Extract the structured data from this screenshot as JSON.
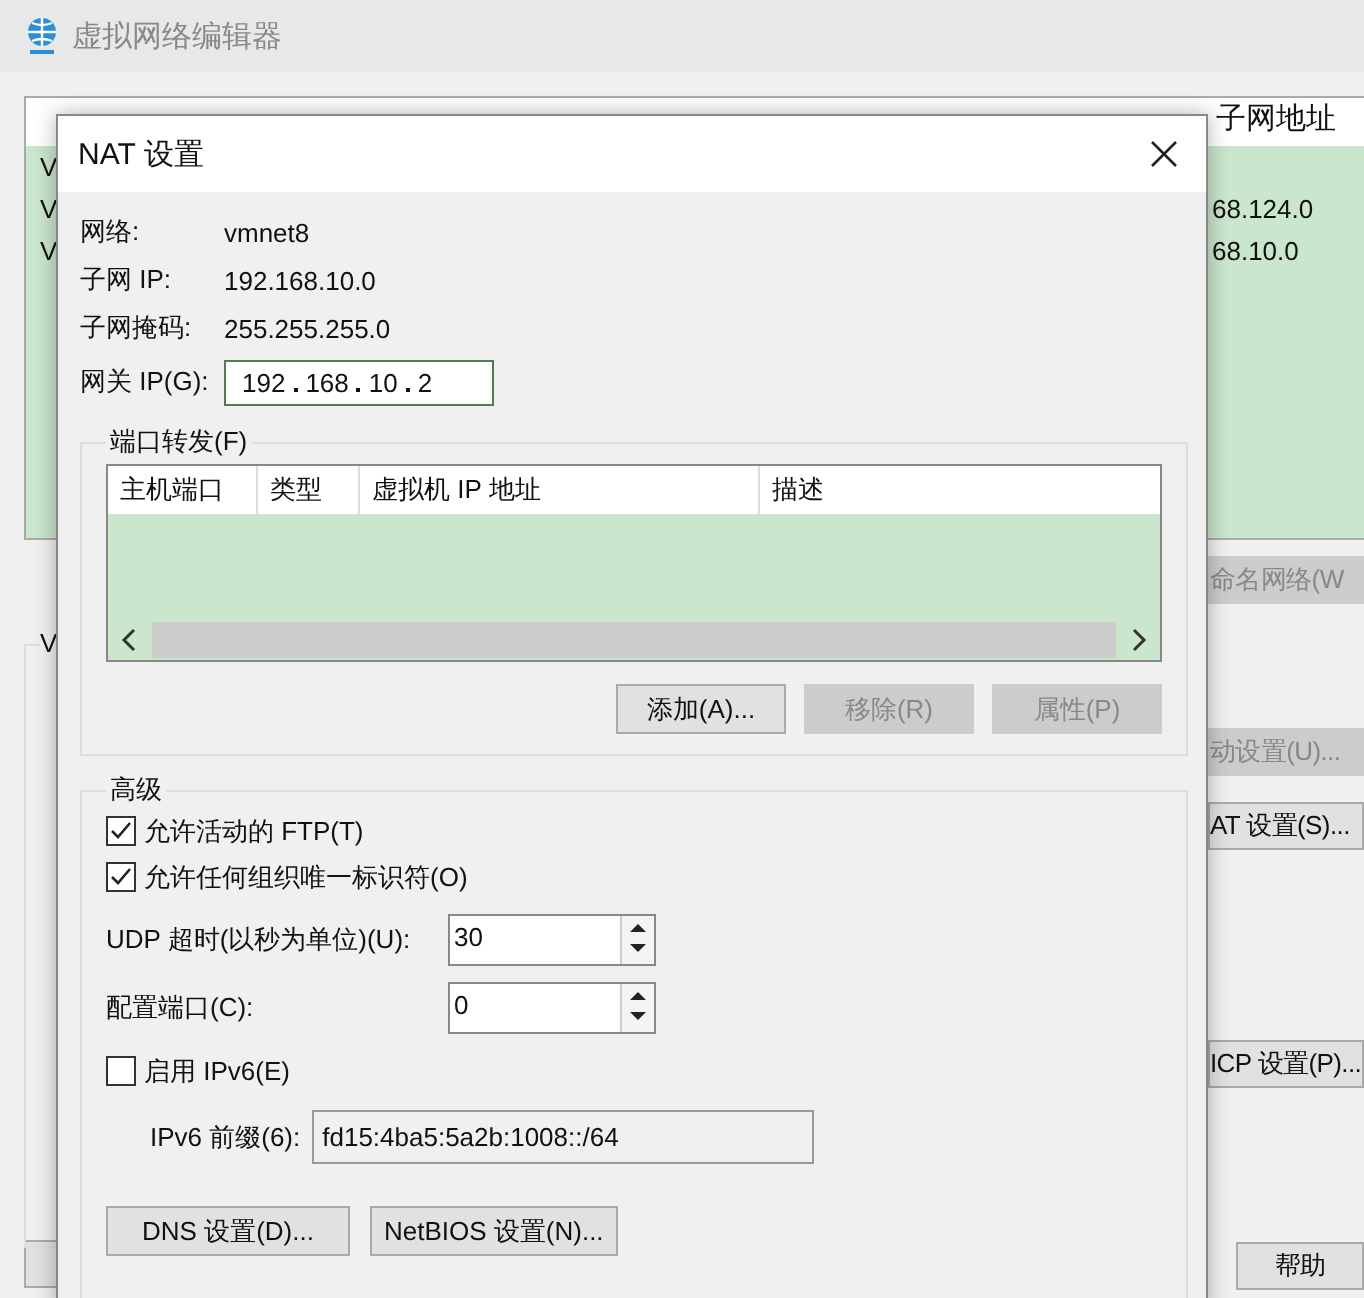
{
  "background_window": {
    "title": "虚拟网络编辑器",
    "table": {
      "column_header": "子网地址",
      "rows": [
        {
          "name": "V",
          "subnet": ""
        },
        {
          "name": "V",
          "subnet": "68.124.0"
        },
        {
          "name": "V",
          "subnet": "68.10.0"
        }
      ]
    },
    "group_label": "V",
    "side_buttons": [
      {
        "label": "命名网络(W",
        "disabled": true
      },
      {
        "label": "动设置(U)...",
        "disabled": true
      },
      {
        "label": "AT 设置(S)...",
        "disabled": false
      },
      {
        "label": "ICP 设置(P)...",
        "disabled": false
      }
    ],
    "help_button": "帮助"
  },
  "dialog": {
    "title": "NAT 设置",
    "info": [
      {
        "label": "网络:",
        "value": "vmnet8"
      },
      {
        "label": "子网 IP:",
        "value": "192.168.10.0"
      },
      {
        "label": "子网掩码:",
        "value": "255.255.255.0"
      }
    ],
    "gateway": {
      "label": "网关 IP(G):",
      "octets": [
        "192",
        "168",
        "10",
        "2"
      ]
    },
    "port_forwarding": {
      "title": "端口转发(F)",
      "columns": [
        "主机端口",
        "类型",
        "虚拟机 IP 地址",
        "描述"
      ],
      "buttons": [
        {
          "label": "添加(A)...",
          "disabled": false
        },
        {
          "label": "移除(R)",
          "disabled": true
        },
        {
          "label": "属性(P)",
          "disabled": true
        }
      ]
    },
    "advanced": {
      "title": "高级",
      "checkboxes": [
        {
          "label": "允许活动的 FTP(T)",
          "checked": true
        },
        {
          "label": "允许任何组织唯一标识符(O)",
          "checked": true
        }
      ],
      "spinners": [
        {
          "label": "UDP 超时(以秒为单位)(U):",
          "value": "30"
        },
        {
          "label": "配置端口(C):",
          "value": "0"
        }
      ],
      "ipv6": {
        "label": "启用 IPv6(E)",
        "checked": false
      },
      "prefix": {
        "label": "IPv6 前缀(6):",
        "value": "fd15:4ba5:5a2b:1008::/64",
        "disabled": true
      },
      "buttons": [
        "DNS 设置(D)...",
        "NetBIOS 设置(N)..."
      ]
    }
  }
}
